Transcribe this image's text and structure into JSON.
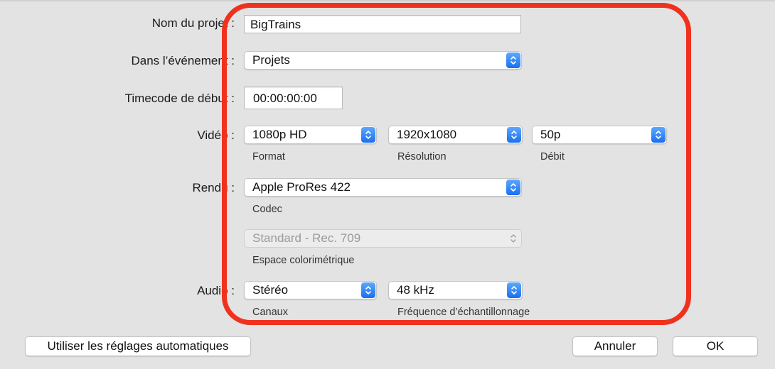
{
  "form": {
    "project_name": {
      "label": "Nom du projet :",
      "value": "BigTrains"
    },
    "event": {
      "label": "Dans l’événement :",
      "value": "Projets"
    },
    "timecode": {
      "label": "Timecode de début :",
      "value": "00:00:00:00"
    },
    "video": {
      "label": "Vidéo :",
      "format": {
        "value": "1080p HD",
        "caption": "Format"
      },
      "resolution": {
        "value": "1920x1080",
        "caption": "Résolution"
      },
      "rate": {
        "value": "50p",
        "caption": "Débit"
      }
    },
    "render": {
      "label": "Rendu :",
      "codec": {
        "value": "Apple ProRes 422",
        "caption": "Codec"
      },
      "colorspace": {
        "value": "Standard - Rec. 709",
        "caption": "Espace colorimétrique"
      }
    },
    "audio": {
      "label": "Audio :",
      "channels": {
        "value": "Stéréo",
        "caption": "Canaux"
      },
      "sample_rate": {
        "value": "48 kHz",
        "caption": "Fréquence d’échantillonnage"
      }
    }
  },
  "buttons": {
    "auto_settings": "Utiliser les réglages automatiques",
    "cancel": "Annuler",
    "ok": "OK"
  },
  "colors": {
    "highlight": "#f0311e",
    "stepper_blue": "#1a6ff0",
    "background": "#e3e3e3"
  },
  "icons": {
    "popup_stepper": "up-down-chevron-icon"
  }
}
